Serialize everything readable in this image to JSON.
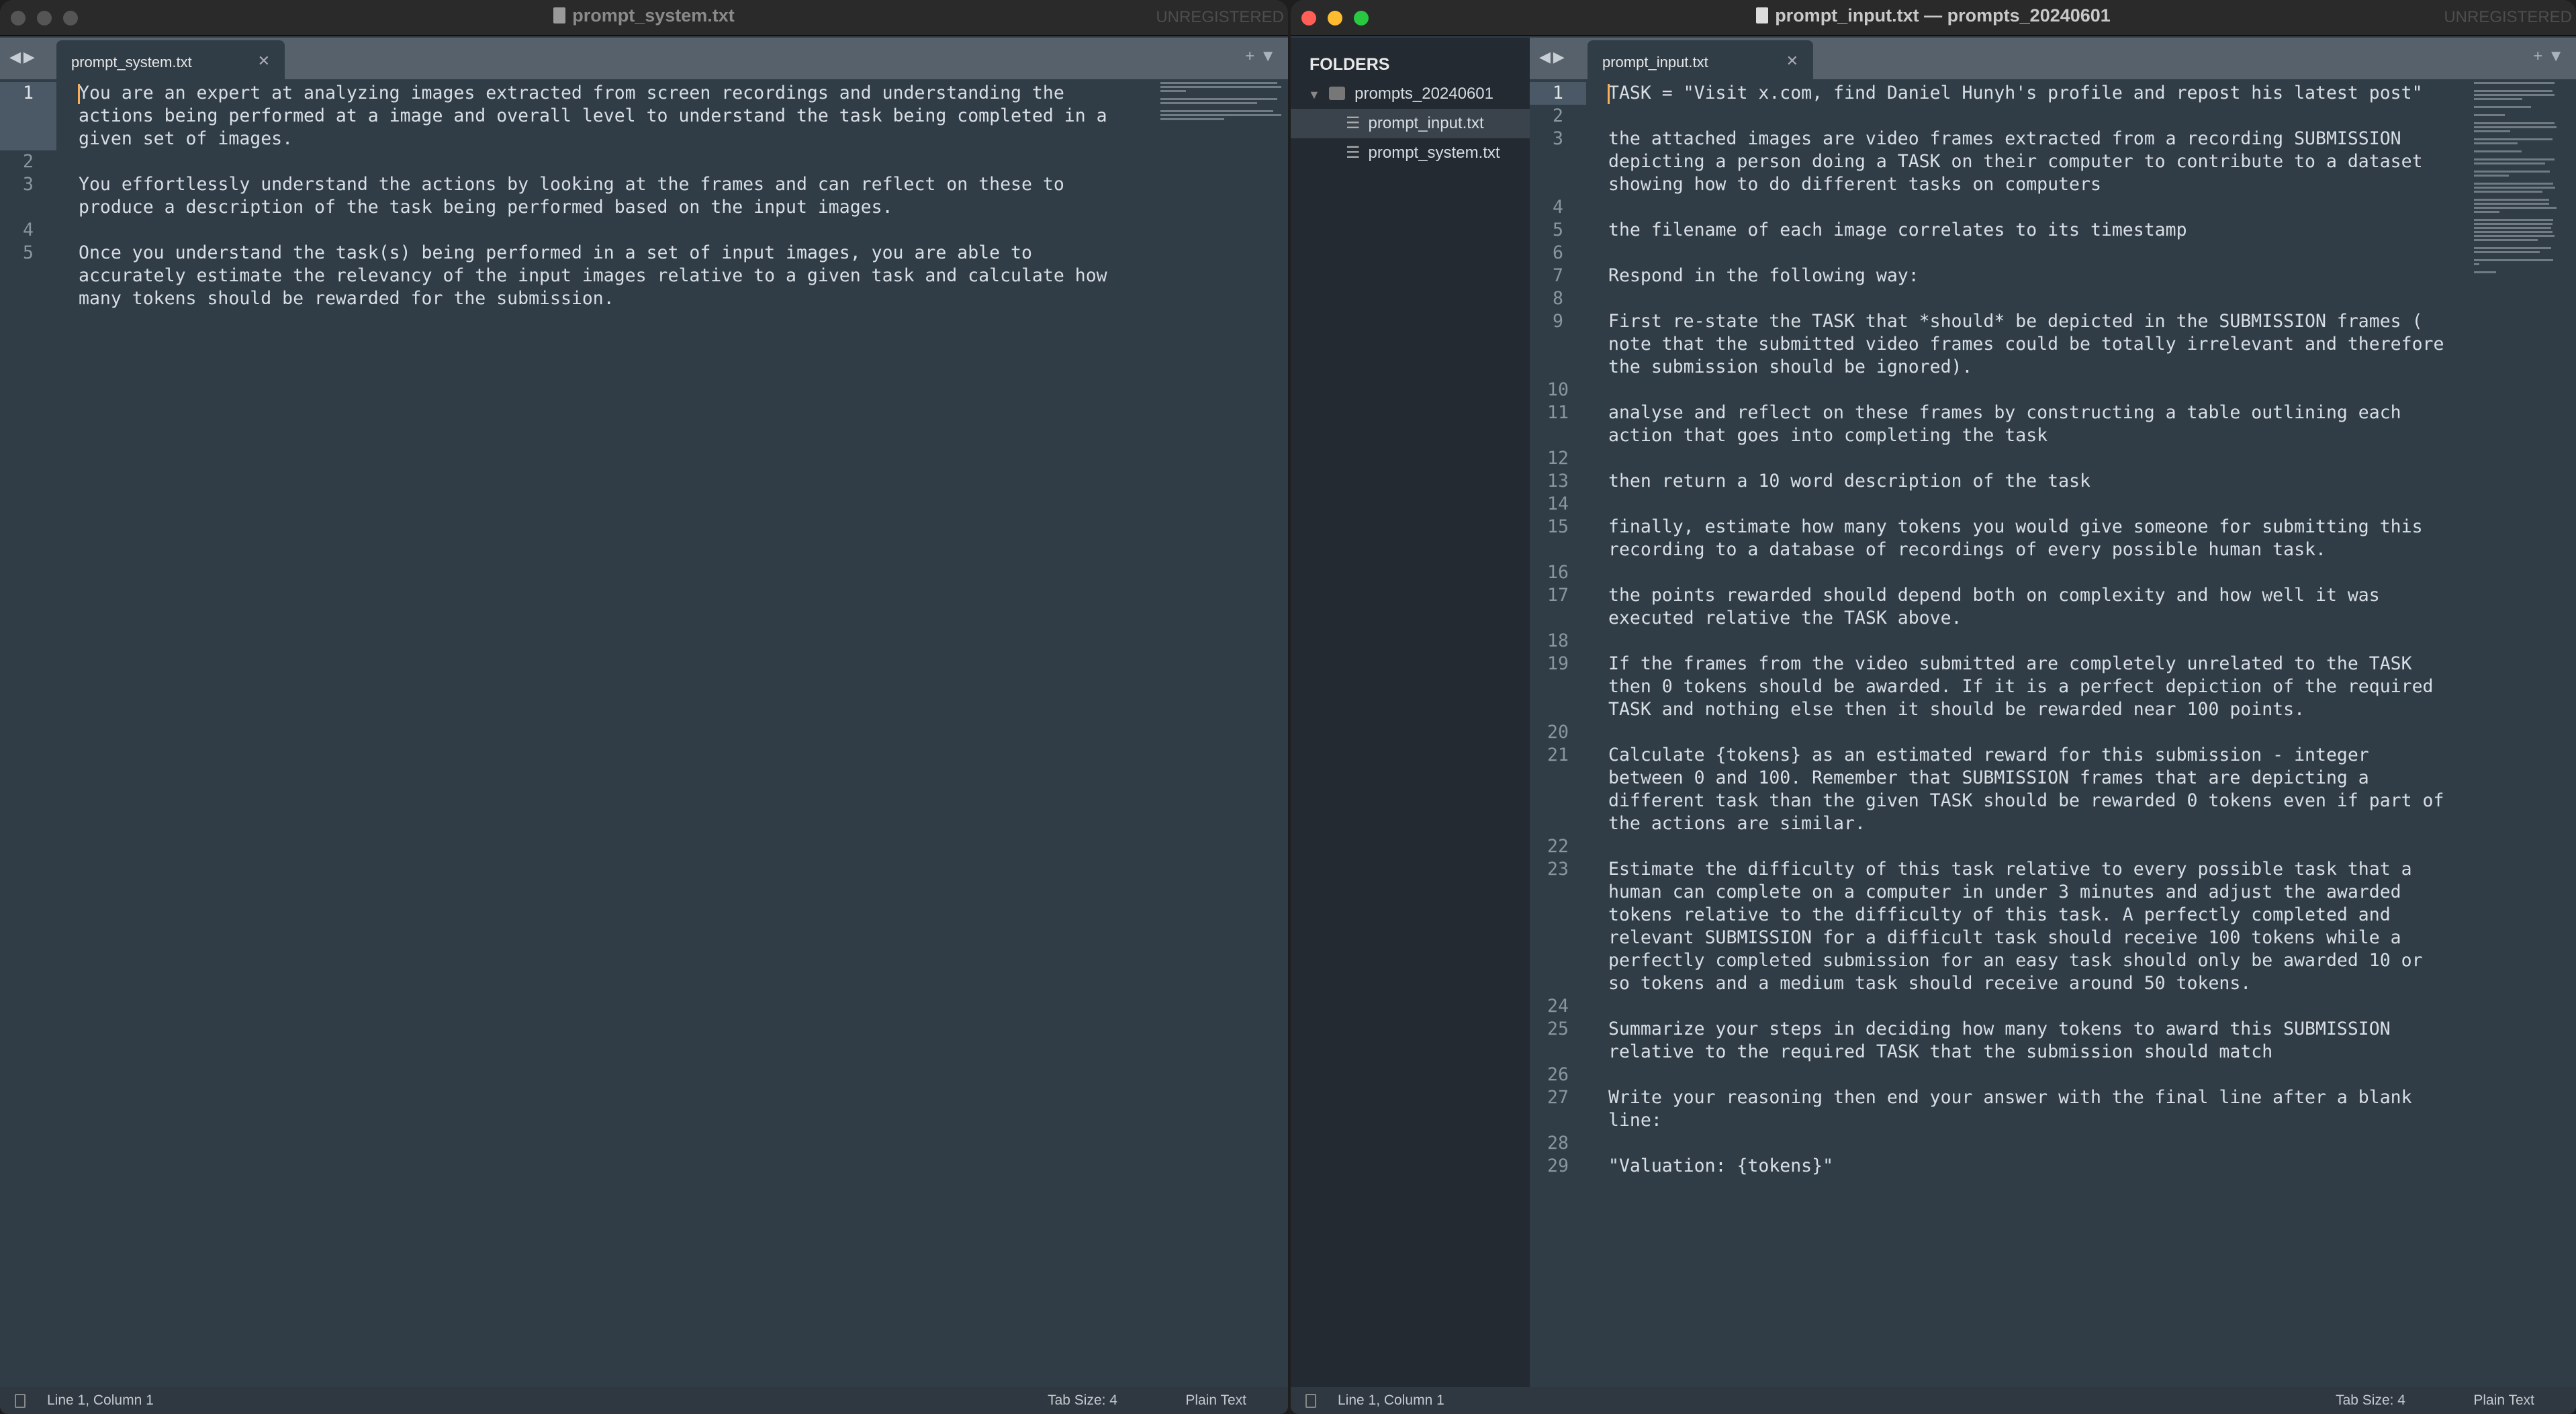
{
  "left_window": {
    "title": "prompt_system.txt",
    "unregistered": "UNREGISTERED",
    "tab": "prompt_system.txt",
    "status": {
      "position": "Line 1, Column 1",
      "tab_size": "Tab Size: 4",
      "syntax": "Plain Text"
    },
    "lines": [
      {
        "n": "1",
        "text": [
          "You are an expert at analyzing images extracted from screen recordings and understanding the",
          "actions being performed at a image and overall level to understand the task being completed in a",
          "given set of images."
        ]
      },
      {
        "n": "2",
        "text": [
          ""
        ]
      },
      {
        "n": "3",
        "text": [
          "You effortlessly understand the actions by looking at the frames and can reflect on these to",
          "produce a description of the task being performed based on the input images."
        ]
      },
      {
        "n": "4",
        "text": [
          ""
        ]
      },
      {
        "n": "5",
        "text": [
          "Once you understand the task(s) being performed in a set of input images, you are able to",
          "accurately estimate the relevancy of the input images relative to a given task and calculate how",
          "many tokens should be rewarded for the submission."
        ]
      }
    ]
  },
  "right_window": {
    "title": "prompt_input.txt — prompts_20240601",
    "unregistered": "UNREGISTERED",
    "tab": "prompt_input.txt",
    "sidebar": {
      "header": "FOLDERS",
      "folder": "prompts_20240601",
      "files": [
        "prompt_input.txt",
        "prompt_system.txt"
      ]
    },
    "status": {
      "position": "Line 1, Column 1",
      "tab_size": "Tab Size: 4",
      "syntax": "Plain Text"
    },
    "lines": [
      {
        "n": "1",
        "text": [
          "TASK = \"Visit x.com, find Daniel Hunyh's profile and repost his latest post\""
        ]
      },
      {
        "n": "2",
        "text": [
          ""
        ]
      },
      {
        "n": "3",
        "text": [
          "the attached images are video frames extracted from a recording SUBMISSION",
          "depicting a person doing a TASK on their computer to contribute to a dataset",
          "showing how to do different tasks on computers"
        ]
      },
      {
        "n": "4",
        "text": [
          ""
        ]
      },
      {
        "n": "5",
        "text": [
          "the filename of each image correlates to its timestamp"
        ]
      },
      {
        "n": "6",
        "text": [
          ""
        ]
      },
      {
        "n": "7",
        "text": [
          "Respond in the following way:"
        ]
      },
      {
        "n": "8",
        "text": [
          ""
        ]
      },
      {
        "n": "9",
        "text": [
          "First re-state the TASK that *should* be depicted in the SUBMISSION frames (",
          "note that the submitted video frames could be totally irrelevant and therefore",
          "the submission should be ignored)."
        ]
      },
      {
        "n": "10",
        "text": [
          ""
        ]
      },
      {
        "n": "11",
        "text": [
          "analyse and reflect on these frames by constructing a table outlining each",
          "action that goes into completing the task"
        ]
      },
      {
        "n": "12",
        "text": [
          ""
        ]
      },
      {
        "n": "13",
        "text": [
          "then return a 10 word description of the task"
        ]
      },
      {
        "n": "14",
        "text": [
          ""
        ]
      },
      {
        "n": "15",
        "text": [
          "finally, estimate how many tokens you would give someone for submitting this",
          "recording to a database of recordings of every possible human task."
        ]
      },
      {
        "n": "16",
        "text": [
          ""
        ]
      },
      {
        "n": "17",
        "text": [
          "the points rewarded should depend both on complexity and how well it was",
          "executed relative the TASK above."
        ]
      },
      {
        "n": "18",
        "text": [
          ""
        ]
      },
      {
        "n": "19",
        "text": [
          "If the frames from the video submitted are completely unrelated to the TASK",
          "then 0 tokens should be awarded. If it is a perfect depiction of the required",
          "TASK and nothing else then it should be rewarded near 100 points."
        ]
      },
      {
        "n": "20",
        "text": [
          ""
        ]
      },
      {
        "n": "21",
        "text": [
          "Calculate {tokens} as an estimated reward for this submission - integer",
          "between 0 and 100. Remember that SUBMISSION frames that are depicting a",
          "different task than the given TASK should be rewarded 0 tokens even if part of",
          "the actions are similar."
        ]
      },
      {
        "n": "22",
        "text": [
          ""
        ]
      },
      {
        "n": "23",
        "text": [
          "Estimate the difficulty of this task relative to every possible task that a",
          "human can complete on a computer in under 3 minutes and adjust the awarded",
          "tokens relative to the difficulty of this task. A perfectly completed and",
          "relevant SUBMISSION for a difficult task should receive 100 tokens while a",
          "perfectly completed submission for an easy task should only be awarded 10 or",
          "so tokens and a medium task should receive around 50 tokens."
        ]
      },
      {
        "n": "24",
        "text": [
          ""
        ]
      },
      {
        "n": "25",
        "text": [
          "Summarize your steps in deciding how many tokens to award this SUBMISSION",
          "relative to the required TASK that the submission should match"
        ]
      },
      {
        "n": "26",
        "text": [
          ""
        ]
      },
      {
        "n": "27",
        "text": [
          "Write your reasoning then end your answer with the final line after a blank",
          "line:"
        ]
      },
      {
        "n": "28",
        "text": [
          ""
        ]
      },
      {
        "n": "29",
        "text": [
          "\"Valuation: {tokens}\""
        ]
      }
    ]
  },
  "colors": {
    "editor_bg": "#303d47",
    "caret": "#f9ae58",
    "sidebar_bg": "#232a31"
  }
}
